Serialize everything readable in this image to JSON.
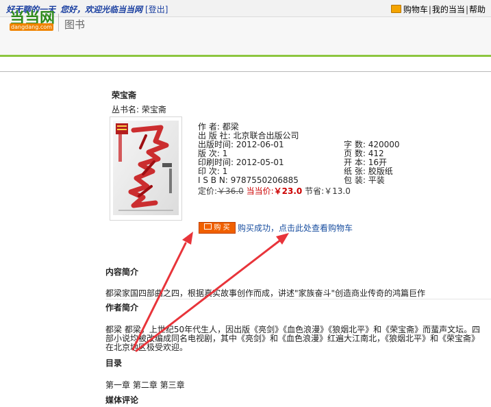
{
  "topbar": {
    "user": "好无聊的一天",
    "greeting": "您好，欢迎光临当当网",
    "logout": "登出",
    "links": [
      "购物车",
      "我的当当",
      "帮助"
    ]
  },
  "header": {
    "logo_cn": "当当网",
    "logo_en": "dangdang.com",
    "section": "图书"
  },
  "book": {
    "title": "荣宝斋",
    "series_label": "丛书名:",
    "series_value": "荣宝斋",
    "cover_text": "荣宝斋",
    "cover_author": "都梁",
    "info_left": [
      {
        "label": "作 者:",
        "value": "都梁"
      },
      {
        "label": "出 版 社:",
        "value": "北京联合出版公司"
      },
      {
        "label": "出版时间:",
        "value": "2012-06-01"
      },
      {
        "label": "版 次:",
        "value": "1"
      },
      {
        "label": "印刷时间:",
        "value": "2012-05-01"
      },
      {
        "label": "印 次:",
        "value": "1"
      },
      {
        "label": "I S B N:",
        "value": "9787550206885"
      }
    ],
    "info_right": [
      {
        "label": "字 数:",
        "value": "420000"
      },
      {
        "label": "页 数:",
        "value": "412"
      },
      {
        "label": "开 本:",
        "value": "16开"
      },
      {
        "label": "纸 张:",
        "value": "胶版纸"
      },
      {
        "label": "包 装:",
        "value": "平装"
      }
    ],
    "price": {
      "list_label": "定价:",
      "list_value": "￥36.0",
      "current_label": "当当价:",
      "current_value": "￥23.0",
      "save_label": "节省:",
      "save_value": "￥13.0"
    },
    "buy_label": "购 买",
    "buy_message": "购买成功，点击此处查看购物车"
  },
  "sections": {
    "intro_title": "内容简介",
    "intro_body": "都梁家国四部曲之四，根据真实故事创作而成，讲述\"家族奋斗\"创造商业传奇的鸿篇巨作",
    "author_title": "作者简介",
    "author_body_1": "都梁 都梁，上世纪50年代生人，因出版《亮剑》《血色浪漫》《狼烟北平》和《荣宝斋》而蜚声文坛。四",
    "author_body_2": "部小说均被改编成同名电视剧，其中《亮剑》和《血色浪漫》红遍大江南北，《狼烟北平》和《荣宝斋》",
    "author_body_3": "在北京地区极受欢迎。",
    "toc_title": "目录",
    "toc_body": "第一章 第二章 第三章",
    "media_title": "媒体评论"
  },
  "colors": {
    "brand_green": "#2e8b1a",
    "brand_orange": "#f08300",
    "price_red": "#cc0000",
    "arrow_red": "#e8343a",
    "link_blue": "#1a4fa0"
  }
}
